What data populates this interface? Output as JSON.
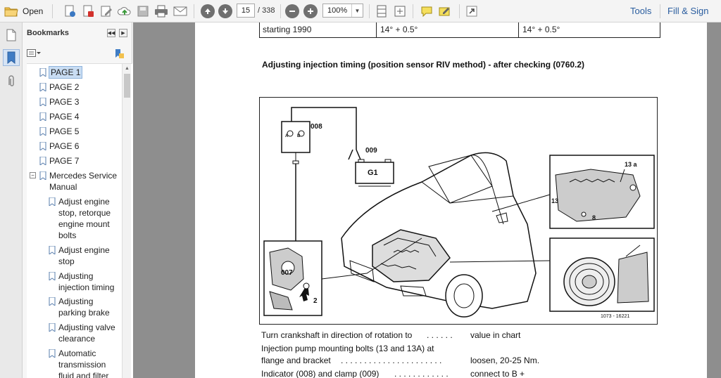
{
  "toolbar": {
    "open_label": "Open",
    "current_page": "15",
    "total_pages": "/ 338",
    "zoom": "100%",
    "tools_label": "Tools",
    "fill_sign_label": "Fill & Sign"
  },
  "bookmarks": {
    "title": "Bookmarks",
    "options_icon": "bookmark-options-icon",
    "items": [
      {
        "label": "PAGE 1"
      },
      {
        "label": "PAGE 2"
      },
      {
        "label": "PAGE 3"
      },
      {
        "label": "PAGE 4"
      },
      {
        "label": "PAGE 5"
      },
      {
        "label": "PAGE 6"
      },
      {
        "label": "PAGE 7"
      },
      {
        "label": "Mercedes Service Manual"
      },
      {
        "label": "Adjust engine stop, retorque engine mount bolts"
      },
      {
        "label": "Adjust engine stop"
      },
      {
        "label": "Adjusting injection timing"
      },
      {
        "label": "Adjusting parking brake"
      },
      {
        "label": "Adjusting valve clearance"
      },
      {
        "label": "Automatic transmission fluid and filter"
      }
    ]
  },
  "document": {
    "table_row": [
      "starting 1990",
      "14° + 0.5°",
      "14° + 0.5°"
    ],
    "heading": "Adjusting injection timing (position sensor RIV method) - after checking (0760.2)",
    "figure_labels": {
      "tester": "008",
      "clamp": "009",
      "battery": "G1",
      "sensor": "007",
      "pump_bolt": "13 a",
      "pump_13": "13",
      "pump_8": "8",
      "arrow_2": "2",
      "tester_a": "A",
      "tester_b": "B",
      "figure_id": "1073 - 16221"
    },
    "lines": [
      {
        "left": "Turn crankshaft in direction of rotation to",
        "dots": ". . . . . .",
        "right": "value in chart"
      },
      {
        "left": "Injection pump mounting bolts (13 and 13A) at",
        "dots": "",
        "right": ""
      },
      {
        "left": "flange and bracket",
        "dots": ". . . . . . . . . . . . . . . . . . . . . .",
        "right": "loosen, 20-25 Nm."
      },
      {
        "left": "Indicator (008) and clamp (009)",
        "dots": ". . . . . . . . . . . .",
        "right": "connect to B +"
      }
    ]
  }
}
